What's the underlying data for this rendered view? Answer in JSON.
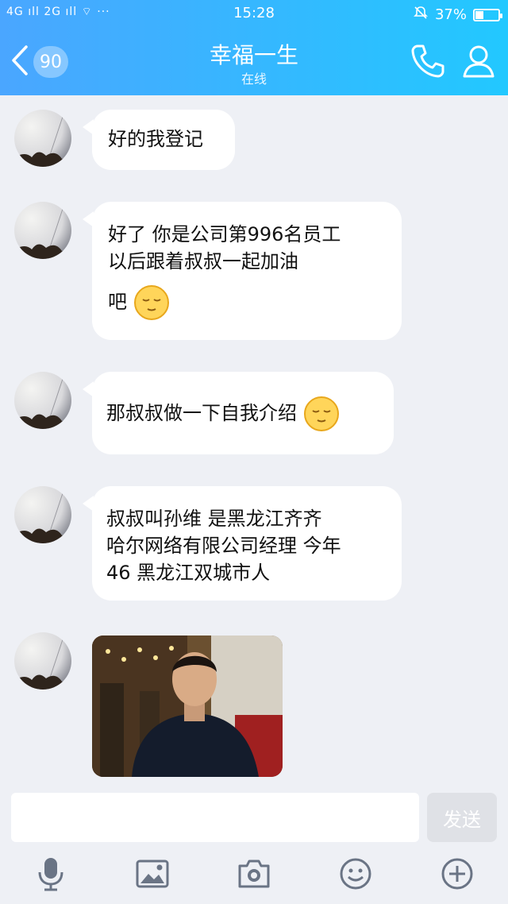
{
  "status_bar": {
    "signal": "4G ıll 2G ıll ⌔ ···",
    "time": "15:28",
    "battery": "37%",
    "battery_level": 0.37
  },
  "header": {
    "unread_count": "90",
    "title": "幸福一生",
    "status": "在线",
    "accent_start": "#4aa6ff",
    "accent_end": "#22c8ff"
  },
  "messages": [
    {
      "lines": [
        "好的我登记"
      ]
    },
    {
      "lines": [
        "好了  你是公司第996名员工",
        "以后跟着叔叔一起加油",
        "吧"
      ],
      "emoji_after_last": true
    },
    {
      "lines": [
        "那叔叔做一下自我介绍"
      ],
      "emoji_after_last": true
    },
    {
      "lines": [
        "叔叔叫孙维  是黑龙江齐齐",
        "哈尔网络有限公司经理 今年",
        "46     黑龙江双城市人"
      ]
    },
    {
      "image": "portrait-photo"
    }
  ],
  "input": {
    "placeholder": "",
    "send_label": "发送"
  },
  "toolbar": {
    "icons": [
      "microphone-icon",
      "image-icon",
      "camera-icon",
      "emoji-icon",
      "plus-icon"
    ]
  }
}
